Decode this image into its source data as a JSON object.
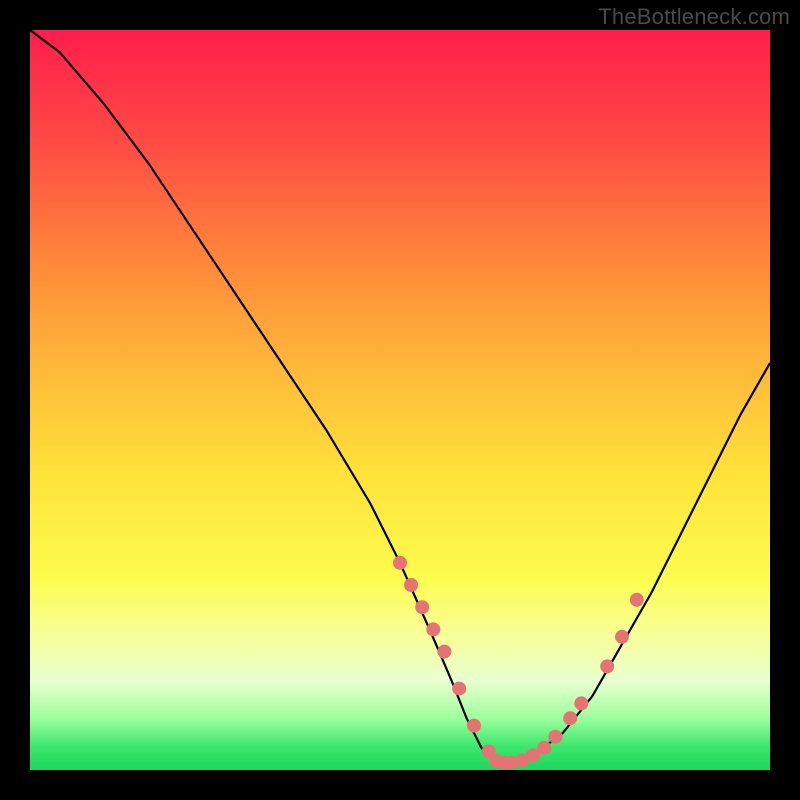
{
  "watermark": "TheBottleneck.com",
  "chart_data": {
    "type": "line",
    "title": "",
    "xlabel": "",
    "ylabel": "",
    "xlim": [
      0,
      100
    ],
    "ylim": [
      0,
      100
    ],
    "series": [
      {
        "name": "bottleneck-curve",
        "x": [
          0,
          4,
          10,
          16,
          22,
          28,
          34,
          40,
          46,
          50,
          54,
          57,
          59,
          61,
          63,
          65,
          68,
          72,
          76,
          80,
          84,
          88,
          92,
          96,
          100
        ],
        "y": [
          100,
          97,
          90,
          82,
          73,
          64,
          55,
          46,
          36,
          28,
          19,
          12,
          7,
          3,
          1,
          1,
          2,
          5,
          10,
          17,
          24,
          32,
          40,
          48,
          55
        ]
      }
    ],
    "markers": {
      "name": "highlight-points",
      "color": "#e57373",
      "x": [
        50,
        51.5,
        53,
        54.5,
        56,
        58,
        60,
        62,
        63,
        64,
        65,
        66.5,
        68,
        69.5,
        71,
        73,
        74.5,
        78,
        80,
        82
      ],
      "y": [
        28,
        25,
        22,
        19,
        16,
        11,
        6,
        2.5,
        1.2,
        1,
        1,
        1.3,
        2,
        3,
        4.5,
        7,
        9,
        14,
        18,
        23
      ]
    },
    "background_gradient": [
      "#ff1d4c",
      "#ffe23a",
      "#1fd65e"
    ]
  }
}
